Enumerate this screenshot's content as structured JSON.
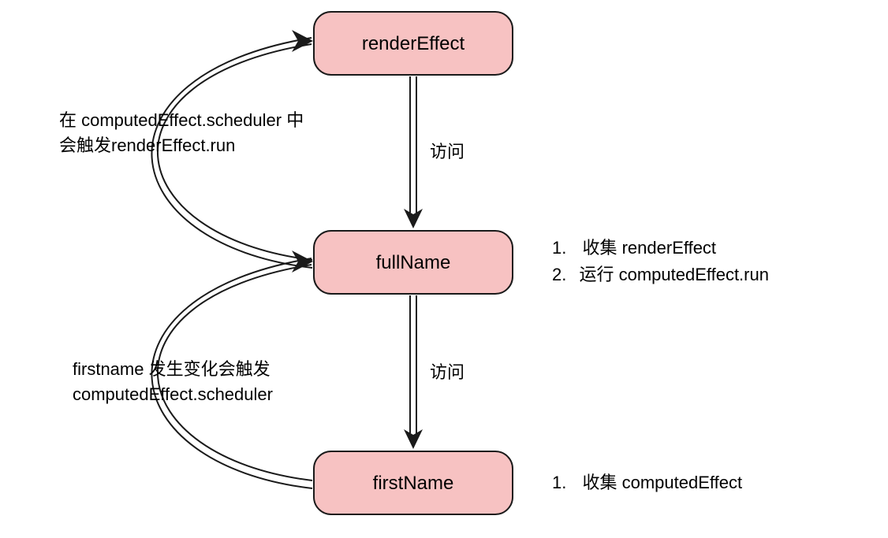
{
  "nodes": {
    "renderEffect": {
      "label": "renderEffect"
    },
    "fullName": {
      "label": "fullName"
    },
    "firstName": {
      "label": "firstName"
    }
  },
  "edges": {
    "render_to_full": {
      "label": "访问"
    },
    "full_to_first": {
      "label": "访问"
    },
    "full_to_render": {
      "line1": "在 computedEffect.scheduler 中",
      "line2": "会触发renderEffect.run"
    },
    "first_to_full": {
      "line1": "firstname 发生变化会触发",
      "line2": "computedEffect.scheduler"
    }
  },
  "annotations": {
    "fullName": {
      "item1": "收集 renderEffect",
      "item2": "运行 computedEffect.run"
    },
    "firstName": {
      "item1": "收集 computedEffect"
    }
  },
  "list_markers": {
    "one": "1.",
    "two": "2."
  }
}
